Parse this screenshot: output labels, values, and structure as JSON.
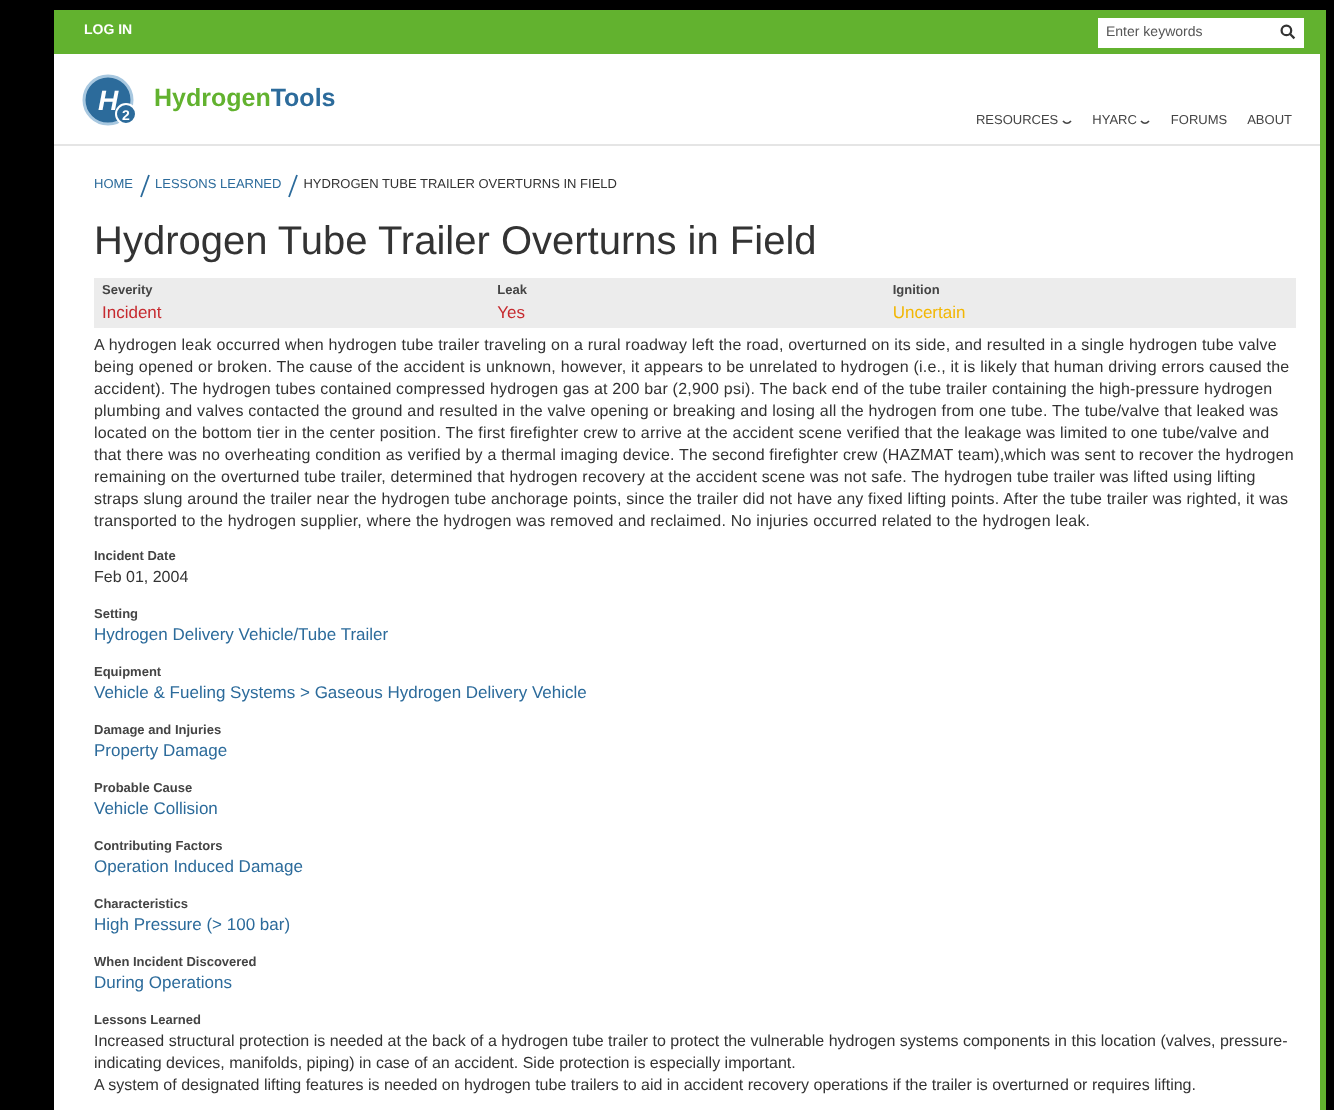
{
  "top_bar": {
    "login": "LOG IN",
    "search": {
      "placeholder": "Enter keywords"
    }
  },
  "header": {
    "logo": {
      "mark": "H",
      "mark_sub": "2",
      "part_1": "Hydrogen",
      "part_2": "Tools"
    },
    "nav": [
      {
        "label": "RESOURCES",
        "dropdown": true
      },
      {
        "label": "HYARC",
        "dropdown": true
      },
      {
        "label": "FORUMS",
        "dropdown": false
      },
      {
        "label": "ABOUT",
        "dropdown": false
      }
    ]
  },
  "breadcrumb": [
    {
      "label": "HOME",
      "link": true
    },
    {
      "label": "LESSONS LEARNED",
      "link": true
    },
    {
      "label": "HYDROGEN TUBE TRAILER OVERTURNS IN FIELD",
      "link": false
    }
  ],
  "title": "Hydrogen Tube Trailer Overturns in Field",
  "summary": [
    {
      "label": "Severity",
      "value": "Incident",
      "color": "#c62a2f"
    },
    {
      "label": "Leak",
      "value": "Yes",
      "color": "#c62a2f"
    },
    {
      "label": "Ignition",
      "value": "Uncertain",
      "color": "#f2b705"
    }
  ],
  "description": "A hydrogen leak occurred when hydrogen tube trailer traveling on a rural roadway left the road, overturned on its side, and resulted in a single hydrogen tube valve being opened or broken. The cause of the accident is unknown, however, it appears to be unrelated to hydrogen (i.e., it is likely that human driving errors caused the accident). The hydrogen tubes contained compressed hydrogen gas at 200 bar (2,900 psi). The back end of the tube trailer containing the high-pressure hydrogen plumbing and valves contacted the ground and resulted in the valve opening or breaking and losing all the hydrogen from one tube. The tube/valve that leaked was located on the bottom tier in the center position. The first firefighter crew to arrive at the accident scene verified that the leakage was limited to one tube/valve and that there was no overheating condition as verified by a thermal imaging device. The second firefighter crew (HAZMAT team),which was sent to recover the hydrogen remaining on the overturned tube trailer, determined that hydrogen recovery at the accident scene was not safe. The hydrogen tube trailer was lifted using lifting straps slung around the trailer near the hydrogen tube anchorage points, since the trailer did not have any fixed lifting points. After the tube trailer was righted, it was transported to the hydrogen supplier, where the hydrogen was removed and reclaimed. No injuries occurred related to the hydrogen leak.",
  "fields": [
    {
      "label": "Incident Date",
      "kind": "text",
      "values": [
        "Feb 01, 2004"
      ]
    },
    {
      "label": "Setting",
      "kind": "link",
      "values": [
        "Hydrogen Delivery Vehicle/Tube Trailer"
      ]
    },
    {
      "label": "Equipment",
      "kind": "link",
      "values": [
        "Vehicle & Fueling Systems > Gaseous Hydrogen Delivery Vehicle"
      ]
    },
    {
      "label": "Damage and Injuries",
      "kind": "link",
      "values": [
        "Property Damage"
      ]
    },
    {
      "label": "Probable Cause",
      "kind": "link",
      "values": [
        "Vehicle Collision"
      ]
    },
    {
      "label": "Contributing Factors",
      "kind": "link",
      "values": [
        "Operation Induced Damage"
      ]
    },
    {
      "label": "Characteristics",
      "kind": "link",
      "values": [
        "High Pressure (> 100 bar)"
      ]
    },
    {
      "label": "When Incident Discovered",
      "kind": "link",
      "values": [
        "During Operations"
      ]
    },
    {
      "label": "Lessons Learned",
      "kind": "text",
      "values": [
        "Increased structural protection is needed at the back of a hydrogen tube trailer to protect the vulnerable hydrogen systems components in this location (valves, pressure-indicating devices, manifolds, piping) in case of an accident. Side protection is especially important.",
        "A system of designated lifting features is needed on hydrogen tube trailers to aid in accident recovery operations if the trailer is overturned or requires lifting."
      ]
    }
  ]
}
